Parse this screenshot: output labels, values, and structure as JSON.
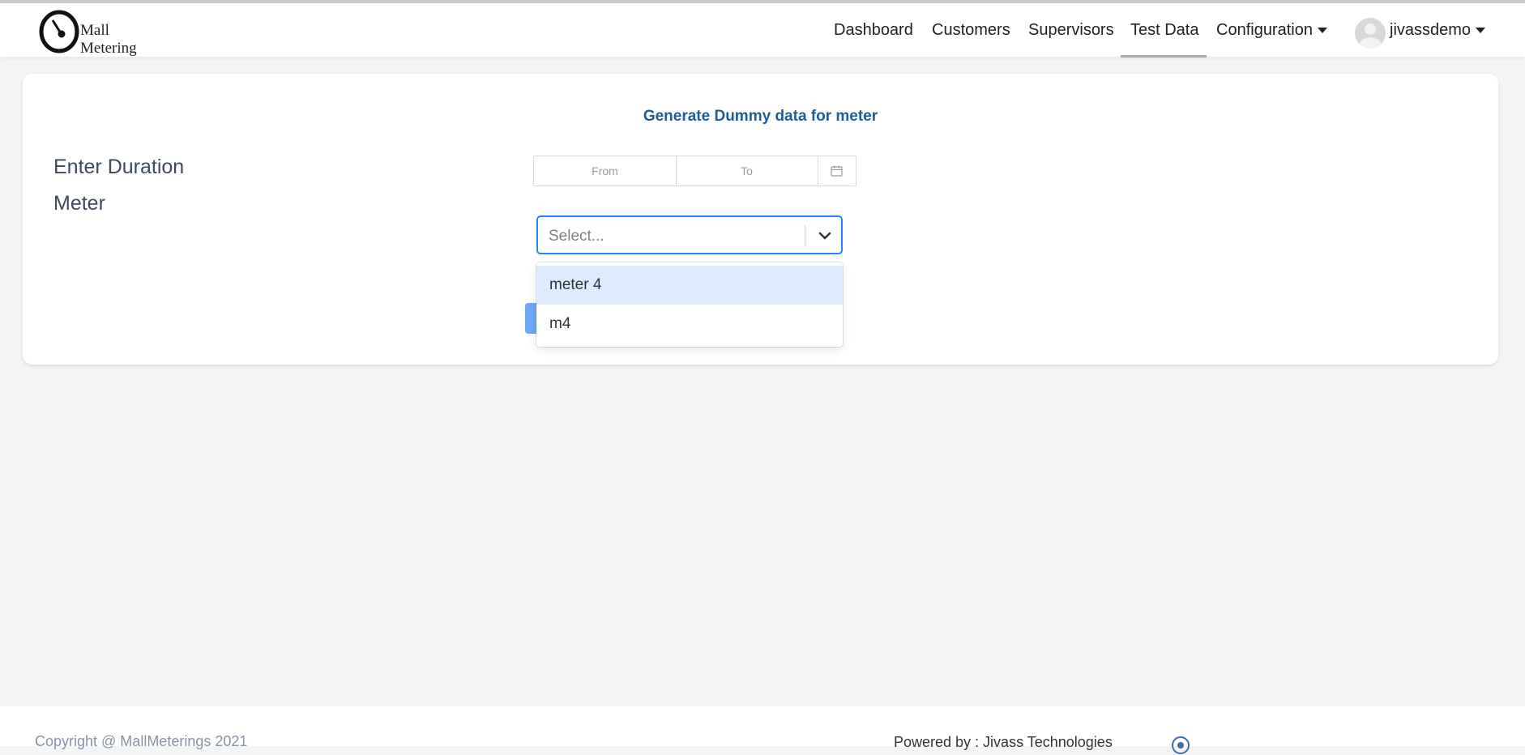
{
  "brand": {
    "name": "Mall Metering",
    "logo_icon": "gauge-icon"
  },
  "nav": {
    "items": [
      {
        "label": "Dashboard"
      },
      {
        "label": "Customers"
      },
      {
        "label": "Supervisors"
      },
      {
        "label": "Test Data",
        "active": true
      },
      {
        "label": "Configuration",
        "dropdown": true
      }
    ],
    "user": {
      "name": "jivassdemo",
      "avatar_icon": "user-avatar-icon"
    }
  },
  "card": {
    "title": "Generate Dummy data for meter",
    "duration_label": "Enter Duration",
    "meter_label": "Meter",
    "date_range": {
      "from_placeholder": "From",
      "to_placeholder": "To",
      "icon": "calendar-icon"
    },
    "meter_select": {
      "placeholder": "Select...",
      "icon": "chevron-down-icon",
      "options": [
        {
          "label": "meter 4",
          "focused": true
        },
        {
          "label": "m4"
        }
      ]
    }
  },
  "footer": {
    "copyright": "Copyright @ MallMeterings 2021",
    "powered_by": "Powered by : Jivass Technologies"
  },
  "colors": {
    "accent": "#2684ff",
    "title": "#1f5d99",
    "option_focus": "#deebff",
    "page_bg": "#f3f4f6"
  }
}
